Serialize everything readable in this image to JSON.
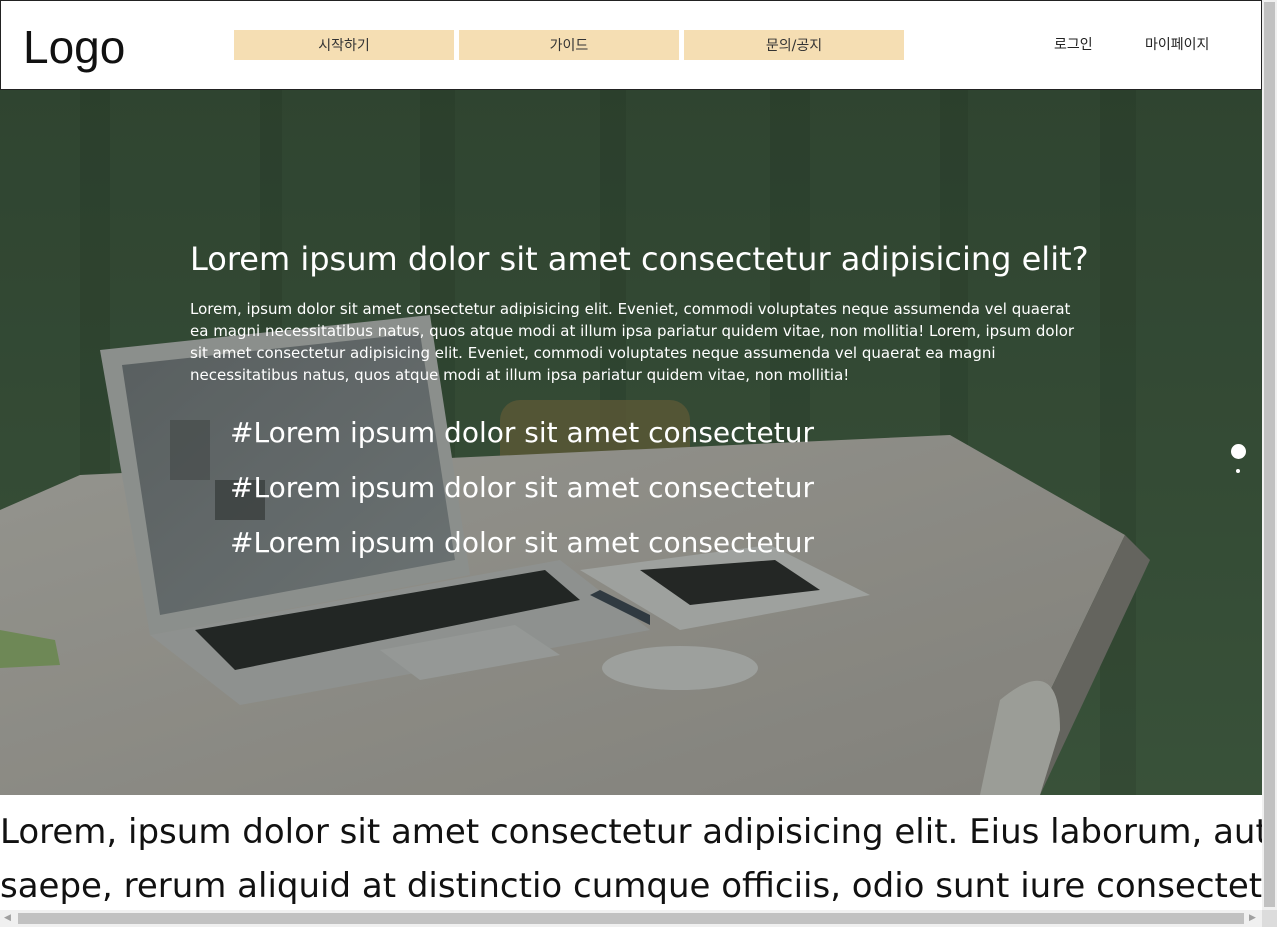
{
  "header": {
    "logo": "Logo",
    "nav": [
      {
        "label": "시작하기"
      },
      {
        "label": "가이드"
      },
      {
        "label": "문의/공지"
      }
    ],
    "login": "로그인",
    "mypage": "마이페이지"
  },
  "hero": {
    "title": "Lorem ipsum dolor sit amet consectetur adipisicing elit?",
    "description": "Lorem, ipsum dolor sit amet consectetur adipisicing elit. Eveniet, commodi voluptates neque assumenda vel quaerat ea magni necessitatibus natus, quos atque modi at illum ipsa pariatur quidem vitae, non mollitia! Lorem, ipsum dolor sit amet consectetur adipisicing elit. Eveniet, commodi voluptates neque assumenda vel quaerat ea magni necessitatibus natus, quos atque modi at illum ipsa pariatur quidem vitae, non mollitia!",
    "tags": [
      "#Lorem ipsum dolor sit amet consectetur",
      "#Lorem ipsum dolor sit amet consectetur",
      "#Lorem ipsum dolor sit amet consectetur"
    ],
    "background": "laptop-desk-photo",
    "pager": {
      "count": 2,
      "active": 1
    }
  },
  "content": {
    "line1": "Lorem, ipsum dolor sit amet consectetur adipisicing elit. Eius laborum, aut porro",
    "line2": "saepe, rerum aliquid at distinctio cumque officiis, odio sunt iure consectetur"
  },
  "colors": {
    "nav_bg": "#f5deb3",
    "hero_wall": "#445d48",
    "text_dark": "#111111"
  }
}
